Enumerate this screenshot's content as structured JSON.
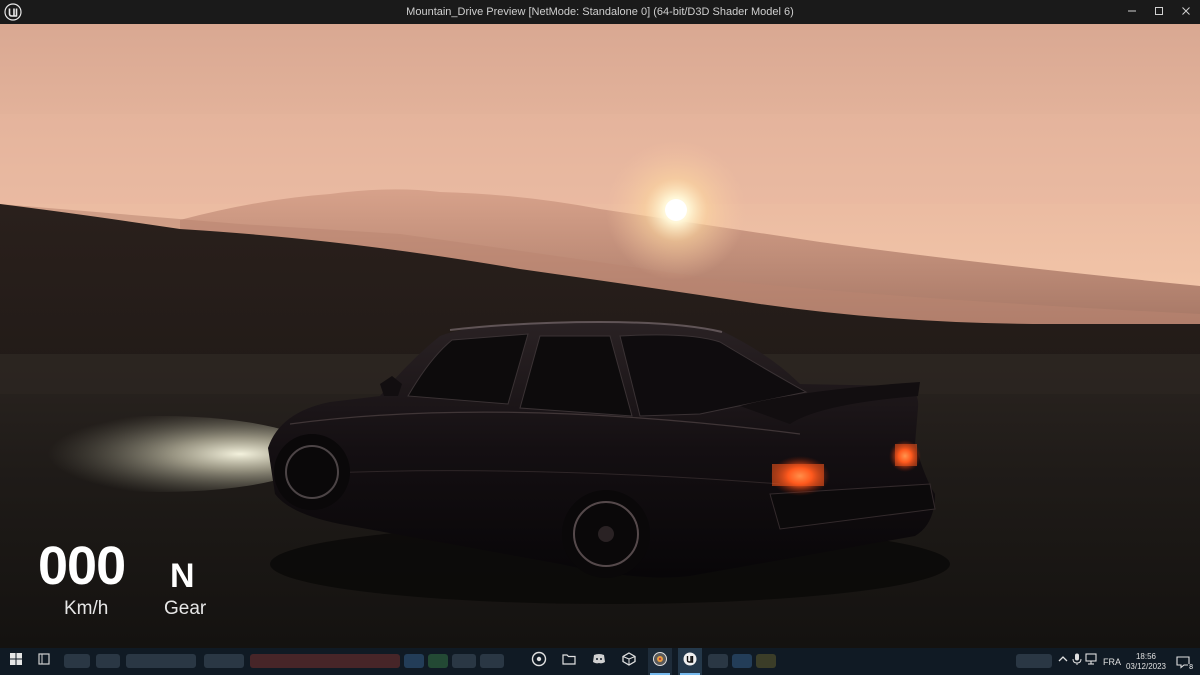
{
  "window": {
    "title": "Mountain_Drive Preview [NetMode: Standalone 0]  (64-bit/D3D Shader Model 6)",
    "logo_icon": "unreal-engine-logo-icon",
    "minimize_icon": "minimize-icon",
    "maximize_icon": "maximize-icon",
    "close_icon": "close-icon"
  },
  "hud": {
    "speed_value": "000",
    "speed_unit": "Km/h",
    "gear_value": "N",
    "gear_label": "Gear"
  },
  "scene": {
    "description_icon": "sunset-car-scene",
    "sky_top_color": "#e2b49e",
    "sky_horizon_color": "#f6c8a8",
    "ground_color": "#1c1a17",
    "taillight_color": "#ff5a1e"
  },
  "taskbar": {
    "start_icon": "windows-start-icon",
    "task_view_icon": "task-view-icon",
    "pinned_icons": [
      "obs-icon",
      "file-explorer-icon",
      "discord-icon",
      "unity-icon",
      "davinci-resolve-icon",
      "unreal-engine-icon"
    ],
    "tray": {
      "chevron_icon": "chevron-up-icon",
      "mic_icon": "microphone-icon",
      "network_icon": "network-icon",
      "language": "FRA",
      "time": "18:56",
      "date": "03/12/2023",
      "notification_icon": "notification-icon",
      "notification_count": "8"
    }
  }
}
